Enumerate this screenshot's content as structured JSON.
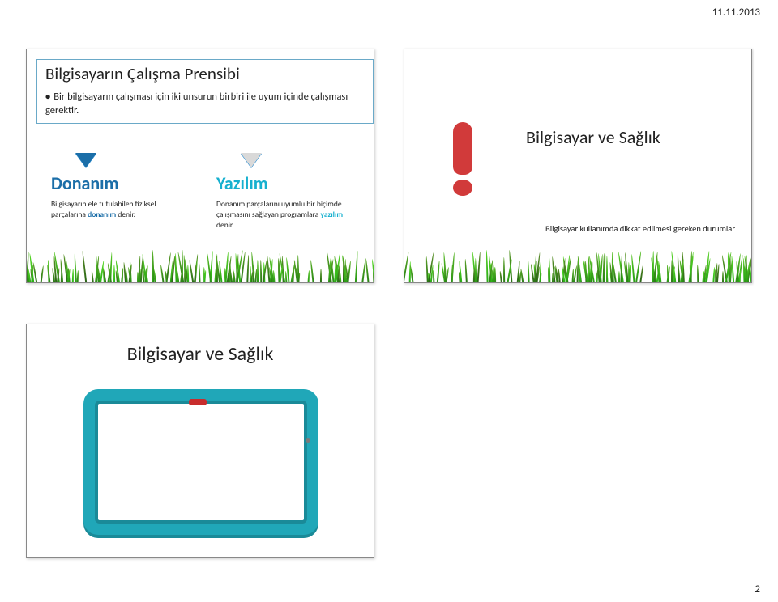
{
  "meta": {
    "date": "11.11.2013",
    "page_number": "2"
  },
  "slide_tl": {
    "title": "Bilgisayarın Çalışma Prensibi",
    "bullet": "Bir bilgisayarın çalışması için iki unsurun birbiri ile uyum içinde çalışması gerektir.",
    "col_left": {
      "heading": "Donanım",
      "desc_pre": "Bilgisayarın ele tutulabilen fiziksel parçalarına ",
      "desc_kw": "donanım",
      "desc_post": " denir."
    },
    "col_right": {
      "heading": "Yazılım",
      "desc_pre": "Donanım parçalarını uyumlu bir biçimde çalışmasını sağlayan programlara ",
      "desc_kw": "yazılım",
      "desc_post": " denir."
    }
  },
  "slide_tr": {
    "title": "Bilgisayar ve Sağlık",
    "subtitle": "Bilgisayar kullanımda dikkat edilmesi gereken durumlar"
  },
  "slide_bl": {
    "title": "Bilgisayar ve Sağlık"
  }
}
